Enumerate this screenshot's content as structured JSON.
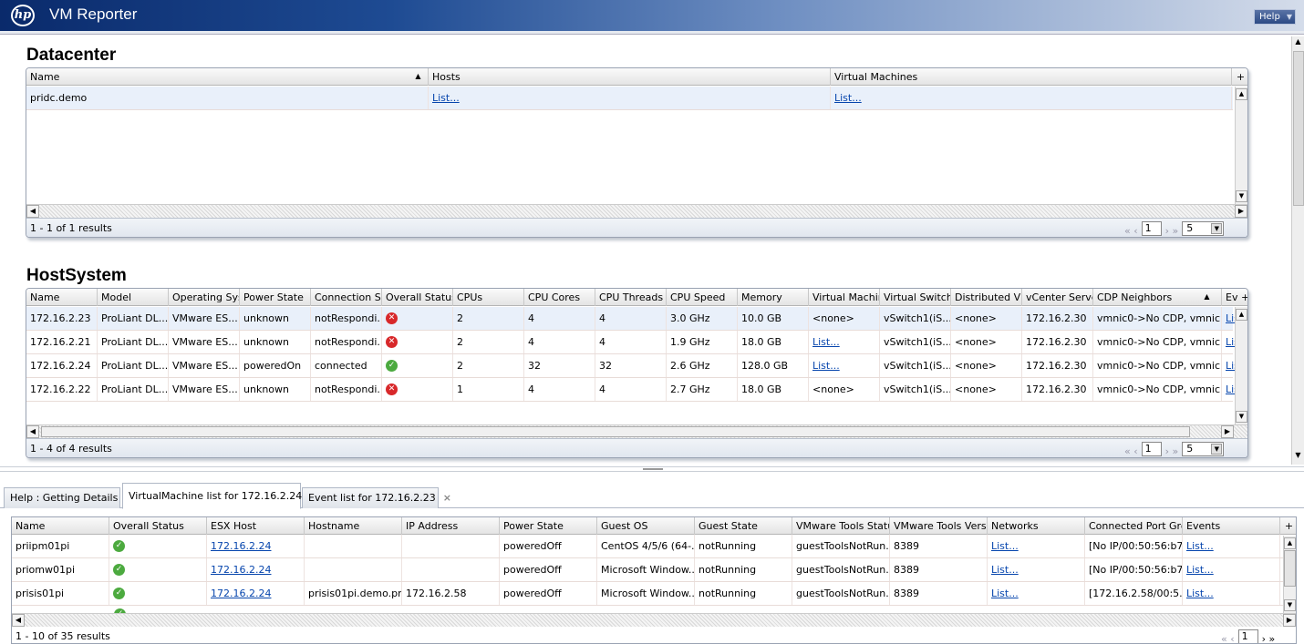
{
  "app": {
    "title": "VM Reporter",
    "logo_text": "hp",
    "help_label": "Help"
  },
  "datacenter": {
    "title": "Datacenter",
    "columns": [
      "Name",
      "Hosts",
      "Virtual Machines"
    ],
    "rows": [
      {
        "name": "pridc.demo",
        "hosts": "List...",
        "vms": "List..."
      }
    ],
    "footer": "1 - 1 of 1 results",
    "page": "1",
    "page_size": "5"
  },
  "hostsystem": {
    "title": "HostSystem",
    "columns": [
      "Name",
      "Model",
      "Operating Syste",
      "Power State",
      "Connection Sta",
      "Overall Status",
      "CPUs",
      "CPU Cores",
      "CPU Threads",
      "CPU Speed",
      "Memory",
      "Virtual Machine",
      "Virtual Switche",
      "Distributed Virtu",
      "vCenter Server",
      "CDP Neighbors",
      "Ev"
    ],
    "rows": [
      {
        "name": "172.16.2.23",
        "model": "ProLiant DL...",
        "os": "VMware ES...",
        "power": "unknown",
        "conn": "notRespondi...",
        "status": "error",
        "cpus": "2",
        "cores": "4",
        "threads": "4",
        "speed": "3.0 GHz",
        "memory": "10.0 GB",
        "vms": "<none>",
        "vswitch": "vSwitch1(iS...",
        "dvs": "<none>",
        "vcenter": "172.16.2.30",
        "cdp": "vmnic0->No CDP, vmnic1...",
        "ev": "Lis"
      },
      {
        "name": "172.16.2.21",
        "model": "ProLiant DL...",
        "os": "VMware ES...",
        "power": "unknown",
        "conn": "notRespondi...",
        "status": "error",
        "cpus": "2",
        "cores": "4",
        "threads": "4",
        "speed": "1.9 GHz",
        "memory": "18.0 GB",
        "vms": "List...",
        "vswitch": "vSwitch1(iS...",
        "dvs": "<none>",
        "vcenter": "172.16.2.30",
        "cdp": "vmnic0->No CDP, vmnic1...",
        "ev": "Lis"
      },
      {
        "name": "172.16.2.24",
        "model": "ProLiant DL...",
        "os": "VMware ES...",
        "power": "poweredOn",
        "conn": "connected",
        "status": "ok",
        "cpus": "2",
        "cores": "32",
        "threads": "32",
        "speed": "2.6 GHz",
        "memory": "128.0 GB",
        "vms": "List...",
        "vswitch": "vSwitch1(iS...",
        "dvs": "<none>",
        "vcenter": "172.16.2.30",
        "cdp": "vmnic0->No CDP, vmnic1...",
        "ev": "Lis"
      },
      {
        "name": "172.16.2.22",
        "model": "ProLiant DL...",
        "os": "VMware ES...",
        "power": "unknown",
        "conn": "notRespondi...",
        "status": "error",
        "cpus": "1",
        "cores": "4",
        "threads": "4",
        "speed": "2.7 GHz",
        "memory": "18.0 GB",
        "vms": "<none>",
        "vswitch": "vSwitch1(iS...",
        "dvs": "<none>",
        "vcenter": "172.16.2.30",
        "cdp": "vmnic0->No CDP, vmnic1...",
        "ev": "Lis"
      }
    ],
    "footer": "1 - 4 of 4 results",
    "page": "1",
    "page_size": "5"
  },
  "tabs": [
    {
      "label": "Help : Getting Details",
      "active": false
    },
    {
      "label": "VirtualMachine list for 172.16.2.24",
      "active": true
    },
    {
      "label": "Event list for 172.16.2.23",
      "active": false
    }
  ],
  "vmlist": {
    "columns": [
      "Name",
      "Overall Status",
      "ESX Host",
      "Hostname",
      "IP Address",
      "Power State",
      "Guest OS",
      "Guest State",
      "VMware Tools Status",
      "VMware Tools Versio",
      "Networks",
      "Connected Port Grou",
      "Events"
    ],
    "rows": [
      {
        "name": "priipm01pi",
        "status": "ok",
        "host": "172.16.2.24",
        "hostname": "",
        "ip": "",
        "power": "poweredOff",
        "os": "CentOS 4/5/6 (64-...",
        "guest": "notRunning",
        "tools": "guestToolsNotRun...",
        "ver": "8389",
        "net": "List...",
        "port": "[No IP/00:50:56:b7...",
        "events": "List..."
      },
      {
        "name": "priomw01pi",
        "status": "ok",
        "host": "172.16.2.24",
        "hostname": "",
        "ip": "",
        "power": "poweredOff",
        "os": "Microsoft Window...",
        "guest": "notRunning",
        "tools": "guestToolsNotRun...",
        "ver": "8389",
        "net": "List...",
        "port": "[No IP/00:50:56:b7...",
        "events": "List..."
      },
      {
        "name": "prisis01pi",
        "status": "ok",
        "host": "172.16.2.24",
        "hostname": "prisis01pi.demo.pr...",
        "ip": "172.16.2.58",
        "power": "poweredOff",
        "os": "Microsoft Window...",
        "guest": "notRunning",
        "tools": "guestToolsNotRun...",
        "ver": "8389",
        "net": "List...",
        "port": "[172.16.2.58/00:5...",
        "events": "List..."
      }
    ],
    "footer": "1 - 10 of 35 results",
    "page": "1"
  },
  "icons": {
    "sort": "sort-asc-icon",
    "add_column": "plus-icon",
    "close_tab": "close-icon"
  },
  "colors": {
    "titlebar": "#1e4b93",
    "link": "#0645ad",
    "error": "#d8282a",
    "ok": "#4caa3f",
    "selected_row": "#e9f0fa"
  }
}
